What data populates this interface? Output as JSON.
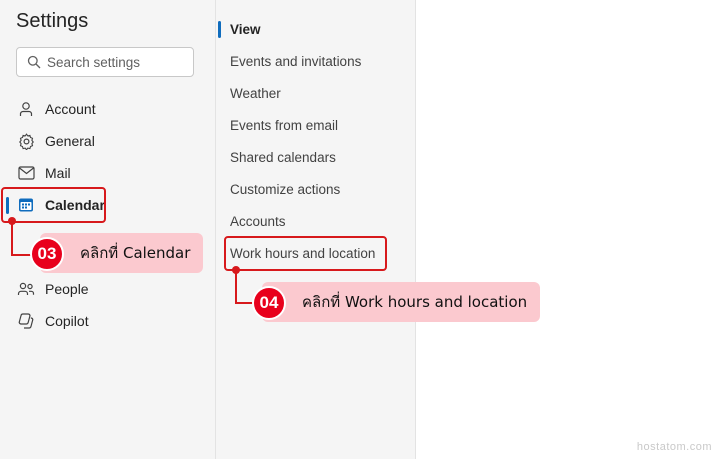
{
  "settings": {
    "title": "Settings",
    "search_placeholder": "Search settings"
  },
  "nav": {
    "items": [
      {
        "label": "Account",
        "icon": "person-icon"
      },
      {
        "label": "General",
        "icon": "gear-icon"
      },
      {
        "label": "Mail",
        "icon": "mail-icon"
      },
      {
        "label": "Calendar",
        "icon": "calendar-icon",
        "selected": true
      },
      {
        "label": "People",
        "icon": "people-icon"
      },
      {
        "label": "Copilot",
        "icon": "copilot-icon"
      }
    ]
  },
  "calendar_sub": {
    "items": [
      {
        "label": "View",
        "selected": true
      },
      {
        "label": "Events and invitations"
      },
      {
        "label": "Weather"
      },
      {
        "label": "Events from email"
      },
      {
        "label": "Shared calendars"
      },
      {
        "label": "Customize actions"
      },
      {
        "label": "Accounts"
      },
      {
        "label": "Work hours and location"
      }
    ]
  },
  "annotations": {
    "step3": {
      "number": "03",
      "text": "คลิกที่ Calendar"
    },
    "step4": {
      "number": "04",
      "text": "คลิกที่ Work hours and location"
    }
  },
  "watermark": "hostatom.com",
  "colors": {
    "accent": "#0f6cbd",
    "annotation_red": "#d7191c",
    "callout_pink": "#fbc9cf"
  }
}
